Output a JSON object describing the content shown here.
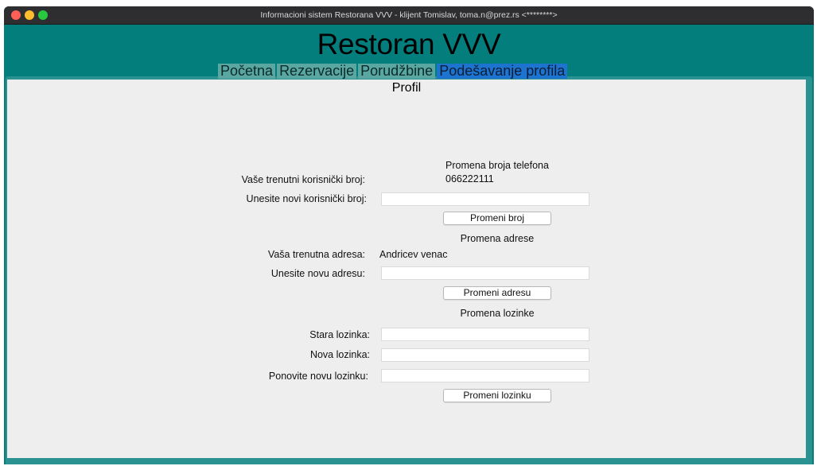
{
  "window": {
    "title": "Informacioni sistem Restorana VVV - klijent Tomislav, toma.n@prez.rs <********>"
  },
  "app": {
    "title": "Restoran VVV"
  },
  "tabs": [
    {
      "label": "Početna"
    },
    {
      "label": "Rezervacije"
    },
    {
      "label": "Porudžbine"
    },
    {
      "label": "Podešavanje profila",
      "active": true
    }
  ],
  "profile": {
    "title": "Profil",
    "phone": {
      "section_title": "Promena broja telefona",
      "current_label": "Vaše trenutni korisnički broj:",
      "current_value": "066222111",
      "new_label": "Unesite novi korisnički broj:",
      "new_value": "",
      "button_label": "Promeni broj"
    },
    "address": {
      "section_title": "Promena adrese",
      "current_label": "Vaša trenutna adresa:",
      "current_value": "Andricev venac",
      "new_label": "Unesite novu adresu:",
      "new_value": "",
      "button_label": "Promeni adresu"
    },
    "password": {
      "section_title": "Promena lozinke",
      "old_label": "Stara lozinka:",
      "new_label": "Nova lozinka:",
      "repeat_label": "Ponovite novu lozinku:",
      "button_label": "Promeni lozinku"
    }
  },
  "colors": {
    "window_bg": "#047d7d",
    "tab_bg": "#5aa7a1",
    "tab_active_bg": "#1d74d0",
    "panel_bg": "#eeeeee"
  }
}
